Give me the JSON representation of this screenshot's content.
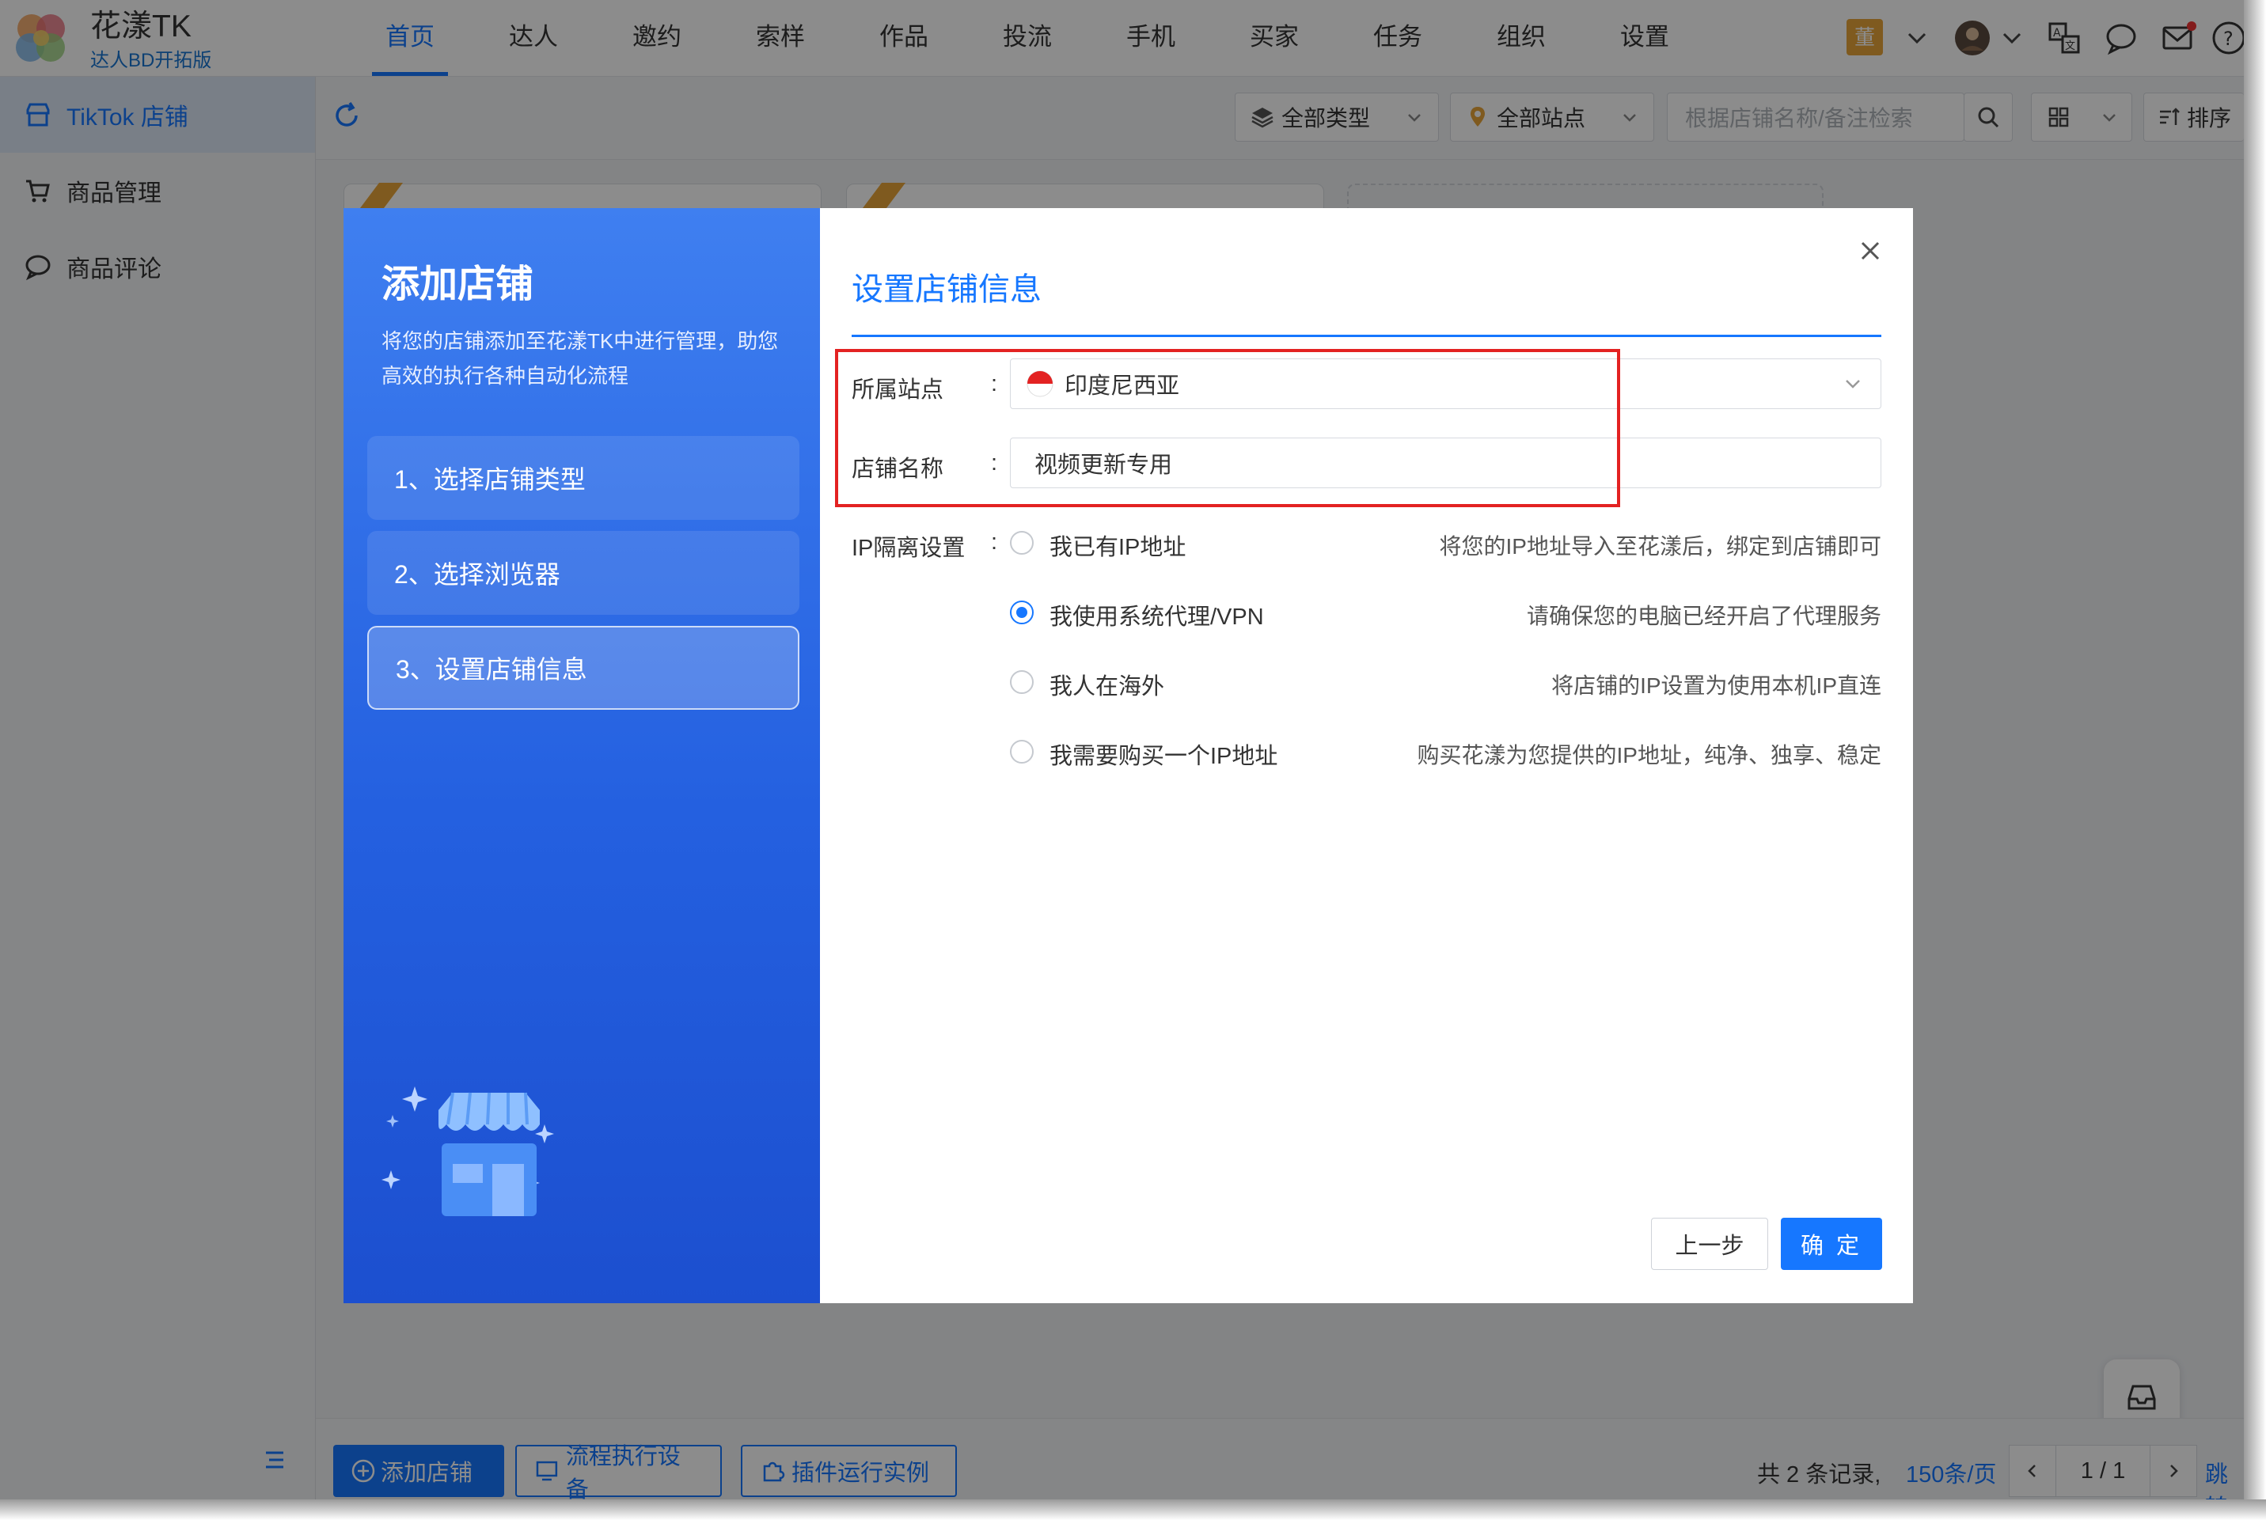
{
  "brand": {
    "name": "花漾TK",
    "subtitle": "达人BD开拓版"
  },
  "nav": {
    "items": [
      "首页",
      "达人",
      "邀约",
      "索样",
      "作品",
      "投流",
      "手机",
      "买家",
      "任务",
      "组织",
      "设置"
    ],
    "active_index": 0,
    "user_badge": "董"
  },
  "sidebar": {
    "items": [
      {
        "label": "TikTok 店铺",
        "icon": "shop-icon",
        "active": true
      },
      {
        "label": "商品管理",
        "icon": "cart-icon",
        "active": false
      },
      {
        "label": "商品评论",
        "icon": "chat-bubble-icon",
        "active": false
      }
    ]
  },
  "toolbar": {
    "type_filter": "全部类型",
    "site_filter": "全部站点",
    "search_placeholder": "根据店铺名称/备注检索",
    "sort_label": "排序"
  },
  "footer": {
    "add_shop": "添加店铺",
    "flow_device": "流程执行设备",
    "plugin_instance": "插件运行实例",
    "total_prefix": "共 2 条记录,",
    "page_size": "150条/页",
    "page_indicator": "1 / 1",
    "jump": "跳转"
  },
  "modal": {
    "left": {
      "title": "添加店铺",
      "description": "将您的店铺添加至花漾TK中进行管理，助您高效的执行各种自动化流程",
      "steps": [
        "1、选择店铺类型",
        "2、选择浏览器",
        "3、设置店铺信息"
      ],
      "active_step": 2
    },
    "right": {
      "title": "设置店铺信息",
      "site_label": "所属站点",
      "site_value": "印度尼西亚",
      "name_label": "店铺名称",
      "name_value": "视频更新专用",
      "ip_label": "IP隔离设置",
      "colon": ":",
      "ip_options": [
        {
          "label": "我已有IP地址",
          "desc": "将您的IP地址导入至花漾后，绑定到店铺即可",
          "checked": false
        },
        {
          "label": "我使用系统代理/VPN",
          "desc": "请确保您的电脑已经开启了代理服务",
          "checked": true
        },
        {
          "label": "我人在海外",
          "desc": "将店铺的IP设置为使用本机IP直连",
          "checked": false
        },
        {
          "label": "我需要购买一个IP地址",
          "desc": "购买花漾为您提供的IP地址，纯净、独享、稳定",
          "checked": false
        }
      ],
      "prev_button": "上一步",
      "ok_button": "确 定"
    }
  },
  "colors": {
    "accent": "#1677ff",
    "highlight_box": "#e32222",
    "modal_panel": "#2460e0"
  }
}
